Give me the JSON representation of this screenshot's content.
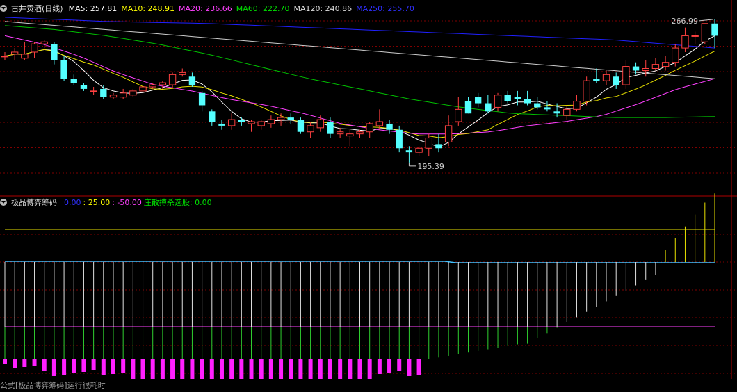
{
  "header": {
    "title": "古井贡酒(日线)",
    "ma": [
      {
        "label": "MA5: 257.81",
        "color": "#ffffff"
      },
      {
        "label": "MA10: 248.91",
        "color": "#ffff00"
      },
      {
        "label": "MA20: 236.66",
        "color": "#ff40ff"
      },
      {
        "label": "MA60: 222.70",
        "color": "#00e000"
      },
      {
        "label": "MA120: 240.86",
        "color": "#dddddd"
      },
      {
        "label": "MA250: 255.70",
        "color": "#3030ff"
      }
    ]
  },
  "indicator": {
    "title": "极品博弈筹码",
    "values": [
      {
        "label": "0.00",
        "color": "#3030ff"
      },
      {
        "label": ": 25.00",
        "color": "#ffff00"
      },
      {
        "label": ": -50.00",
        "color": "#ff40ff"
      },
      {
        "label": "庄散搏杀选股: 0.00",
        "color": "#00e000"
      }
    ]
  },
  "annotations": {
    "high": "266.99",
    "low": "195.39"
  },
  "footer": "公式[极品博弈筹码]运行很耗时",
  "colors": {
    "up": "#ff4040",
    "down": "#54ffff",
    "bg": "#000000",
    "grid": "#800000"
  },
  "chart_data": {
    "type": "candlestick",
    "price_range": [
      185,
      272
    ],
    "candles": [
      [
        252,
        254,
        250,
        252
      ],
      [
        253,
        256,
        250,
        254
      ],
      [
        251,
        259,
        250,
        253
      ],
      [
        254,
        259,
        251,
        258
      ],
      [
        258,
        260,
        256,
        259
      ],
      [
        258,
        259,
        248,
        250
      ],
      [
        250,
        252,
        240,
        241
      ],
      [
        241,
        243,
        238,
        239
      ],
      [
        238,
        239,
        235,
        236
      ],
      [
        235,
        237,
        233,
        235
      ],
      [
        236,
        238,
        231,
        232
      ],
      [
        232,
        234,
        231,
        233
      ],
      [
        232,
        236,
        231,
        234
      ],
      [
        233,
        236,
        232,
        235
      ],
      [
        235,
        238,
        234,
        237
      ],
      [
        237,
        239,
        236,
        238
      ],
      [
        238,
        240,
        236,
        239
      ],
      [
        238,
        244,
        236,
        243
      ],
      [
        243,
        246,
        242,
        244
      ],
      [
        242,
        244,
        237,
        238
      ],
      [
        234,
        235,
        225,
        228
      ],
      [
        225,
        226,
        218,
        220
      ],
      [
        219,
        221,
        216,
        218
      ],
      [
        218,
        224,
        216,
        221
      ],
      [
        221,
        222,
        218,
        220
      ],
      [
        219,
        221,
        215,
        220
      ],
      [
        218,
        221,
        216,
        220
      ],
      [
        219,
        223,
        217,
        221
      ],
      [
        221,
        224,
        218,
        222
      ],
      [
        222,
        224,
        219,
        221
      ],
      [
        221,
        222,
        214,
        215
      ],
      [
        215,
        220,
        212,
        218
      ],
      [
        217,
        223,
        215,
        221
      ],
      [
        220,
        222,
        212,
        214
      ],
      [
        214,
        217,
        212,
        215
      ],
      [
        213,
        216,
        208,
        214
      ],
      [
        214,
        216,
        212,
        215
      ],
      [
        215,
        220,
        212,
        219
      ],
      [
        218,
        226,
        216,
        220
      ],
      [
        219,
        221,
        214,
        216
      ],
      [
        216,
        218,
        205,
        207
      ],
      [
        206,
        208,
        200,
        205
      ],
      [
        205,
        208,
        203,
        207
      ],
      [
        207,
        214,
        203,
        212
      ],
      [
        209,
        214,
        205,
        207
      ],
      [
        210,
        223,
        208,
        218
      ],
      [
        220,
        232,
        218,
        226
      ],
      [
        230,
        232,
        224,
        224
      ],
      [
        232,
        234,
        227,
        229
      ],
      [
        229,
        233,
        224,
        225
      ],
      [
        227,
        234,
        225,
        233
      ],
      [
        233,
        235,
        229,
        230
      ],
      [
        232,
        235,
        228,
        231
      ],
      [
        231,
        235,
        228,
        229
      ],
      [
        229,
        232,
        226,
        227
      ],
      [
        227,
        230,
        225,
        226
      ],
      [
        225,
        229,
        222,
        224
      ],
      [
        223,
        228,
        221,
        226
      ],
      [
        226,
        233,
        225,
        230
      ],
      [
        230,
        242,
        228,
        240
      ],
      [
        241,
        246,
        239,
        240
      ],
      [
        240,
        245,
        238,
        243
      ],
      [
        242,
        244,
        236,
        238
      ],
      [
        238,
        250,
        236,
        247
      ],
      [
        247,
        249,
        243,
        245
      ],
      [
        245,
        250,
        242,
        246
      ],
      [
        246,
        251,
        245,
        248
      ],
      [
        247,
        252,
        245,
        249
      ],
      [
        249,
        258,
        247,
        256
      ],
      [
        256,
        266,
        254,
        262
      ],
      [
        262,
        264,
        258,
        262
      ],
      [
        259,
        268,
        258,
        268
      ],
      [
        268,
        270,
        256,
        262
      ]
    ],
    "ma_lines": [
      "MA5",
      "MA10",
      "MA20",
      "MA60",
      "MA120",
      "MA250"
    ],
    "indicator_bars": {
      "ylim": [
        -100,
        60
      ],
      "levels": [
        0,
        25,
        -50
      ]
    }
  }
}
